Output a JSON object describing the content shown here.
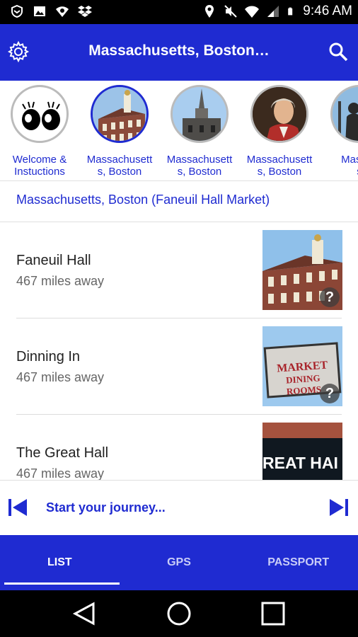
{
  "status_bar": {
    "time": "9:46 AM",
    "left_icons": [
      "vpn-icon",
      "image-icon",
      "wifi-sync-icon",
      "dropbox-icon"
    ],
    "right_icons": [
      "location-icon",
      "mute-icon",
      "wifi-icon",
      "signal-icon",
      "battery-icon"
    ]
  },
  "app_bar": {
    "title": "Massachusetts, Boston…",
    "left_icon": "settings-gear-icon",
    "right_icon": "search-icon"
  },
  "carousel": {
    "items": [
      {
        "label_line1": "Welcome &",
        "label_line2": "Instuctions",
        "image": "eyes-icon",
        "active": false
      },
      {
        "label_line1": "Massachusett",
        "label_line2": "s, Boston",
        "image": "faneuil-hall",
        "active": true
      },
      {
        "label_line1": "Massachusett",
        "label_line2": "s, Boston",
        "image": "steeple",
        "active": false
      },
      {
        "label_line1": "Massachusett",
        "label_line2": "s, Boston",
        "image": "portrait",
        "active": false
      },
      {
        "label_line1": "Massac",
        "label_line2": "s",
        "image": "statue",
        "active": false
      }
    ]
  },
  "location": {
    "text": "Massachusetts, Boston (Faneuil Hall Market)"
  },
  "list": {
    "rows": [
      {
        "name": "Faneuil Hall",
        "distance": "467 miles away",
        "thumb": "faneuil-hall",
        "badge": "?"
      },
      {
        "name": "Dinning In",
        "distance": "467 miles away",
        "thumb": "market-sign",
        "badge": "?",
        "sign_line1": "MARKET",
        "sign_line2": "DINING ROOMS"
      },
      {
        "name": "The Great Hall",
        "distance": "467 miles away",
        "thumb": "great-hall-sign",
        "sign_text": "REAT HAI"
      }
    ]
  },
  "journey": {
    "text": "Start your journey...",
    "prev_icon": "skip-previous-icon",
    "next_icon": "skip-next-icon"
  },
  "tabs": {
    "items": [
      {
        "label": "LIST",
        "active": true
      },
      {
        "label": "GPS",
        "active": false
      },
      {
        "label": "PASSPORT",
        "active": false
      }
    ]
  },
  "colors": {
    "primary": "#1f2bd1",
    "secondary_text": "#666666",
    "status_bar": "#000000"
  }
}
